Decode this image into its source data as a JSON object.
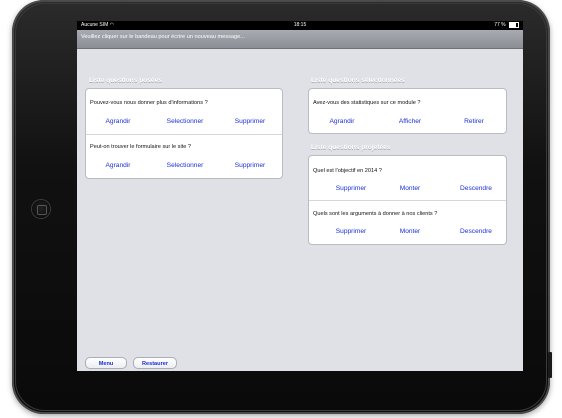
{
  "statusbar": {
    "carrier": "Aucune SIM",
    "wifi_icon": "wifi-icon",
    "time": "18:15",
    "battery": "77 %"
  },
  "banner": {
    "text": "Veuillez cliquer sur le bandeau pour écrire un nouveau message..."
  },
  "asked": {
    "title": "Liste questions posées",
    "items": [
      {
        "question": "Pouvez-vous nous donner plus d'informations ?",
        "actions": [
          "Agrandir",
          "Selectionner",
          "Supprimer"
        ]
      },
      {
        "question": "Peut-on trouver le formulaire sur le site ?",
        "actions": [
          "Agrandir",
          "Selectionner",
          "Supprimer"
        ]
      }
    ]
  },
  "selected": {
    "title": "Liste questions sélectionnées",
    "items": [
      {
        "question": "Avez-vous des statistiques sur ce module ?",
        "actions": [
          "Agrandir",
          "Afficher",
          "Retirer"
        ]
      }
    ]
  },
  "projected": {
    "title": "Liste questions projetées",
    "items": [
      {
        "question": "Quel est l'objectif en 2014 ?",
        "actions": [
          "Supprimer",
          "Monter",
          "Descendre"
        ]
      },
      {
        "question": "Quels sont les arguments à donner à nos clients ?",
        "actions": [
          "Supprimer",
          "Monter",
          "Descendre"
        ]
      }
    ]
  },
  "bottom": {
    "menu_label": "Menu",
    "restore_label": "Restaurer"
  },
  "colors": {
    "link": "#1a2fd6",
    "background": "#dfe1e6",
    "banner": "#9a9da4"
  }
}
